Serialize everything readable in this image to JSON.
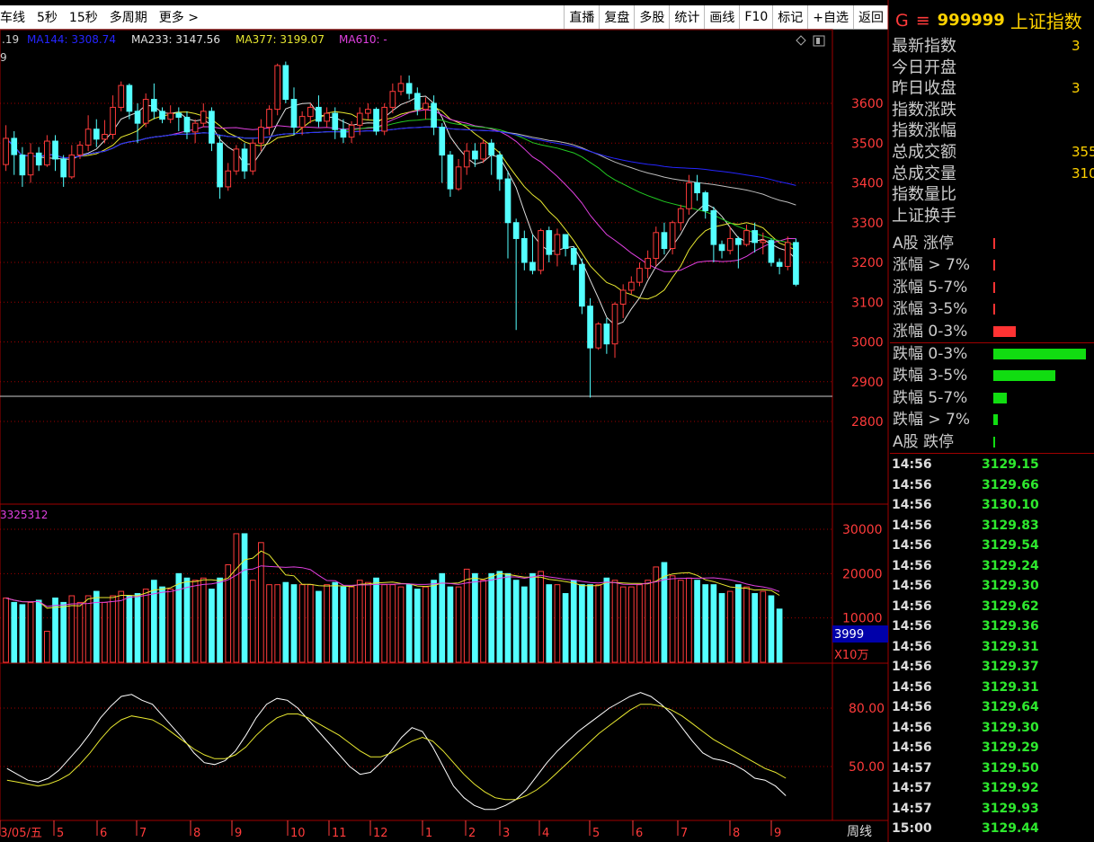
{
  "toolbar": {
    "left_items": [
      "车线",
      "5秒",
      "15秒",
      "多周期",
      "更多 >"
    ],
    "right_items": [
      "直播",
      "复盘",
      "多股",
      "统计",
      "画线",
      "F10",
      "标记",
      "+自选",
      "返回"
    ]
  },
  "ma_labels": [
    {
      "text": ".19",
      "color": "#d0d0d0"
    },
    {
      "text": "MA144: 3308.74",
      "color": "#2525ff"
    },
    {
      "text": "MA233: 3147.56",
      "color": "#e0e0e0"
    },
    {
      "text": "MA377: 3199.07",
      "color": "#e8e830"
    },
    {
      "text": "MA610: -",
      "color": "#e040e0"
    }
  ],
  "corner_icons": [
    "diamond-icon",
    "window-icon"
  ],
  "price_ticks": [
    "3600",
    "3500",
    "3400",
    "3300",
    "3200",
    "3100",
    "3000",
    "2900",
    "2800"
  ],
  "volume_label": "3325312",
  "volume_ticks": [
    "30000",
    "20000",
    "10000"
  ],
  "volume_current": "3999",
  "volume_unit": "X10万",
  "kdj_ticks": [
    "80.00",
    "50.00"
  ],
  "dates": [
    "03/05/五",
    "5",
    "6",
    "7",
    "8",
    "9",
    "10",
    "11",
    "12",
    "1",
    "2",
    "3",
    "4",
    "5",
    "6",
    "7",
    "8",
    "9"
  ],
  "period": "周线",
  "panel_header": {
    "g": "G",
    "menu": "≡",
    "code": "999999",
    "name": "上证指数"
  },
  "quote_labels": [
    "最新指数",
    "今日开盘",
    "昨日收盘",
    "指数涨跌",
    "指数涨幅",
    "总成交额",
    "总成交量",
    "指数量比",
    "上证换手"
  ],
  "quote_values": [
    "3",
    "",
    "3",
    "",
    "",
    "355",
    "310",
    "",
    ""
  ],
  "distribution": [
    {
      "label": "A股 涨停",
      "value": 0.004,
      "color": "#ff3333"
    },
    {
      "label": "涨幅 > 7%",
      "value": 0.004,
      "color": "#ff3333"
    },
    {
      "label": "涨幅 5-7%",
      "value": 0.004,
      "color": "#ff3333"
    },
    {
      "label": "涨幅 3-5%",
      "value": 0.02,
      "color": "#ff3333"
    },
    {
      "label": "涨幅 0-3%",
      "value": 0.24,
      "color": "#ff3333"
    },
    {
      "label": "跌幅 0-3%",
      "value": 1.0,
      "color": "#11dd11"
    },
    {
      "label": "跌幅 3-5%",
      "value": 0.67,
      "color": "#11dd11"
    },
    {
      "label": "跌幅 5-7%",
      "value": 0.15,
      "color": "#11dd11"
    },
    {
      "label": "跌幅 > 7%",
      "value": 0.05,
      "color": "#11dd11"
    },
    {
      "label": "A股 跌停",
      "value": 0.01,
      "color": "#11dd11"
    }
  ],
  "ticks": [
    {
      "time": "14:56",
      "price": "3129.15"
    },
    {
      "time": "14:56",
      "price": "3129.66"
    },
    {
      "time": "14:56",
      "price": "3130.10"
    },
    {
      "time": "14:56",
      "price": "3129.83"
    },
    {
      "time": "14:56",
      "price": "3129.54"
    },
    {
      "time": "14:56",
      "price": "3129.24"
    },
    {
      "time": "14:56",
      "price": "3129.30"
    },
    {
      "time": "14:56",
      "price": "3129.62"
    },
    {
      "time": "14:56",
      "price": "3129.36"
    },
    {
      "time": "14:56",
      "price": "3129.31"
    },
    {
      "time": "14:56",
      "price": "3129.37"
    },
    {
      "time": "14:56",
      "price": "3129.31"
    },
    {
      "time": "14:56",
      "price": "3129.64"
    },
    {
      "time": "14:56",
      "price": "3129.30"
    },
    {
      "time": "14:56",
      "price": "3129.29"
    },
    {
      "time": "14:57",
      "price": "3129.50"
    },
    {
      "time": "14:57",
      "price": "3129.92"
    },
    {
      "time": "14:57",
      "price": "3129.93"
    },
    {
      "time": "15:00",
      "price": "3129.44"
    }
  ],
  "colors": {
    "up": "#ff3b3b",
    "down": "#54ffff",
    "grid": "#a00000",
    "axis": "#ff3b3b"
  },
  "chart_data": {
    "type": "candlestick",
    "period": "周线",
    "ylim": [
      2800,
      3700
    ],
    "candles": [
      [
        3446,
        3512,
        3430,
        3545
      ],
      [
        3512,
        3471,
        3420,
        3530
      ],
      [
        3470,
        3420,
        3390,
        3490
      ],
      [
        3420,
        3475,
        3400,
        3500
      ],
      [
        3475,
        3445,
        3430,
        3490
      ],
      [
        3445,
        3505,
        3440,
        3520
      ],
      [
        3505,
        3460,
        3430,
        3520
      ],
      [
        3460,
        3415,
        3390,
        3470
      ],
      [
        3415,
        3470,
        3410,
        3495
      ],
      [
        3470,
        3495,
        3460,
        3505
      ],
      [
        3495,
        3535,
        3480,
        3570
      ],
      [
        3535,
        3510,
        3490,
        3560
      ],
      [
        3510,
        3522,
        3500,
        3558
      ],
      [
        3522,
        3590,
        3510,
        3620
      ],
      [
        3590,
        3645,
        3580,
        3655
      ],
      [
        3645,
        3580,
        3560,
        3650
      ],
      [
        3580,
        3550,
        3500,
        3600
      ],
      [
        3550,
        3610,
        3540,
        3625
      ],
      [
        3610,
        3580,
        3560,
        3650
      ],
      [
        3580,
        3560,
        3550,
        3590
      ],
      [
        3560,
        3575,
        3550,
        3595
      ],
      [
        3575,
        3565,
        3530,
        3590
      ],
      [
        3565,
        3528,
        3510,
        3580
      ],
      [
        3528,
        3550,
        3500,
        3560
      ],
      [
        3550,
        3580,
        3540,
        3600
      ],
      [
        3580,
        3500,
        3480,
        3590
      ],
      [
        3500,
        3390,
        3360,
        3520
      ],
      [
        3390,
        3430,
        3380,
        3450
      ],
      [
        3430,
        3485,
        3420,
        3495
      ],
      [
        3485,
        3430,
        3410,
        3500
      ],
      [
        3430,
        3500,
        3420,
        3510
      ],
      [
        3500,
        3540,
        3480,
        3560
      ],
      [
        3540,
        3585,
        3520,
        3595
      ],
      [
        3585,
        3695,
        3570,
        3700
      ],
      [
        3695,
        3610,
        3600,
        3705
      ],
      [
        3610,
        3540,
        3520,
        3640
      ],
      [
        3540,
        3567,
        3520,
        3580
      ],
      [
        3567,
        3590,
        3550,
        3600
      ],
      [
        3590,
        3555,
        3540,
        3620
      ],
      [
        3555,
        3575,
        3540,
        3590
      ],
      [
        3575,
        3534,
        3510,
        3590
      ],
      [
        3534,
        3515,
        3500,
        3560
      ],
      [
        3515,
        3545,
        3500,
        3555
      ],
      [
        3545,
        3575,
        3520,
        3590
      ],
      [
        3575,
        3585,
        3560,
        3600
      ],
      [
        3585,
        3530,
        3520,
        3590
      ],
      [
        3530,
        3590,
        3520,
        3600
      ],
      [
        3590,
        3630,
        3575,
        3650
      ],
      [
        3630,
        3650,
        3620,
        3670
      ],
      [
        3650,
        3625,
        3610,
        3670
      ],
      [
        3625,
        3585,
        3570,
        3640
      ],
      [
        3585,
        3600,
        3560,
        3615
      ],
      [
        3600,
        3540,
        3520,
        3620
      ],
      [
        3540,
        3470,
        3400,
        3550
      ],
      [
        3470,
        3385,
        3365,
        3480
      ],
      [
        3385,
        3440,
        3380,
        3460
      ],
      [
        3440,
        3480,
        3420,
        3500
      ],
      [
        3480,
        3460,
        3440,
        3500
      ],
      [
        3460,
        3500,
        3450,
        3510
      ],
      [
        3500,
        3470,
        3420,
        3510
      ],
      [
        3470,
        3410,
        3380,
        3480
      ],
      [
        3410,
        3300,
        3210,
        3430
      ],
      [
        3300,
        3260,
        3030,
        3310
      ],
      [
        3260,
        3200,
        3180,
        3280
      ],
      [
        3200,
        3180,
        3170,
        3270
      ],
      [
        3180,
        3280,
        3170,
        3285
      ],
      [
        3280,
        3220,
        3200,
        3290
      ],
      [
        3220,
        3270,
        3190,
        3285
      ],
      [
        3270,
        3235,
        3215,
        3270
      ],
      [
        3235,
        3195,
        3180,
        3240
      ],
      [
        3195,
        3090,
        3070,
        3210
      ],
      [
        3090,
        2985,
        2860,
        3110
      ],
      [
        2985,
        3045,
        2980,
        3050
      ],
      [
        3045,
        2995,
        2970,
        3060
      ],
      [
        2995,
        3095,
        2960,
        3100
      ],
      [
        3095,
        3130,
        3060,
        3145
      ],
      [
        3130,
        3150,
        3120,
        3165
      ],
      [
        3150,
        3185,
        3140,
        3200
      ],
      [
        3185,
        3210,
        3160,
        3230
      ],
      [
        3210,
        3275,
        3190,
        3290
      ],
      [
        3275,
        3235,
        3220,
        3300
      ],
      [
        3235,
        3300,
        3220,
        3305
      ],
      [
        3300,
        3335,
        3280,
        3345
      ],
      [
        3335,
        3400,
        3320,
        3420
      ],
      [
        3400,
        3375,
        3355,
        3420
      ],
      [
        3375,
        3330,
        3310,
        3380
      ],
      [
        3330,
        3245,
        3200,
        3340
      ],
      [
        3245,
        3230,
        3210,
        3255
      ],
      [
        3230,
        3260,
        3220,
        3290
      ],
      [
        3260,
        3245,
        3185,
        3265
      ],
      [
        3245,
        3280,
        3240,
        3295
      ],
      [
        3280,
        3250,
        3225,
        3300
      ],
      [
        3250,
        3255,
        3220,
        3275
      ],
      [
        3255,
        3200,
        3190,
        3260
      ],
      [
        3200,
        3190,
        3170,
        3210
      ],
      [
        3190,
        3250,
        3180,
        3265
      ],
      [
        3250,
        3145,
        3140,
        3260
      ]
    ],
    "volumes": [
      14500,
      13500,
      13000,
      13500,
      14000,
      7000,
      14500,
      13500,
      15000,
      13500,
      15000,
      16000,
      13500,
      15000,
      16000,
      15000,
      15500,
      16500,
      18500,
      17000,
      16500,
      20000,
      19000,
      18500,
      19000,
      16500,
      19000,
      22000,
      29000,
      29000,
      18500,
      27000,
      17500,
      17500,
      18000,
      17500,
      17500,
      17500,
      16000,
      17500,
      18000,
      17000,
      17000,
      18500,
      18000,
      19000,
      17500,
      17500,
      17000,
      17500,
      16500,
      17000,
      18500,
      20000,
      17000,
      17000,
      21000,
      20000,
      18500,
      20000,
      20500,
      20000,
      18500,
      17000,
      20000,
      20500,
      17500,
      17500,
      15500,
      18500,
      17500,
      17500,
      17500,
      19000,
      18500,
      17000,
      17000,
      17500,
      18500,
      21500,
      22500,
      19500,
      18500,
      19000,
      18500,
      17500,
      17500,
      15500,
      16000,
      17500,
      17000,
      15500,
      16000,
      15000,
      12000
    ],
    "kdj_k": [
      49,
      46,
      43,
      42,
      44,
      48,
      54,
      60,
      67,
      75,
      81,
      86,
      87,
      84,
      82,
      76,
      70,
      64,
      57,
      52,
      51,
      53,
      58,
      66,
      75,
      82,
      85,
      84,
      80,
      74,
      68,
      62,
      56,
      50,
      46,
      47,
      52,
      58,
      65,
      70,
      68,
      60,
      50,
      40,
      34,
      30,
      28,
      28,
      30,
      33,
      38,
      45,
      52,
      58,
      63,
      68,
      72,
      76,
      80,
      83,
      86,
      88,
      86,
      82,
      77,
      70,
      63,
      57,
      54,
      53,
      51,
      48,
      44,
      43,
      40,
      35
    ],
    "kdj_d": [
      43,
      42,
      41,
      40,
      41,
      43,
      46,
      51,
      57,
      64,
      70,
      74,
      76,
      75,
      74,
      71,
      67,
      63,
      59,
      56,
      54,
      54,
      56,
      60,
      66,
      71,
      75,
      77,
      77,
      75,
      72,
      69,
      66,
      62,
      58,
      55,
      55,
      57,
      60,
      63,
      65,
      63,
      58,
      52,
      46,
      41,
      37,
      34,
      33,
      33,
      35,
      38,
      42,
      47,
      52,
      57,
      62,
      67,
      71,
      75,
      79,
      82,
      82,
      81,
      79,
      76,
      72,
      68,
      64,
      61,
      58,
      55,
      52,
      49,
      47,
      44
    ],
    "kdj_ylim": [
      30,
      95
    ]
  }
}
